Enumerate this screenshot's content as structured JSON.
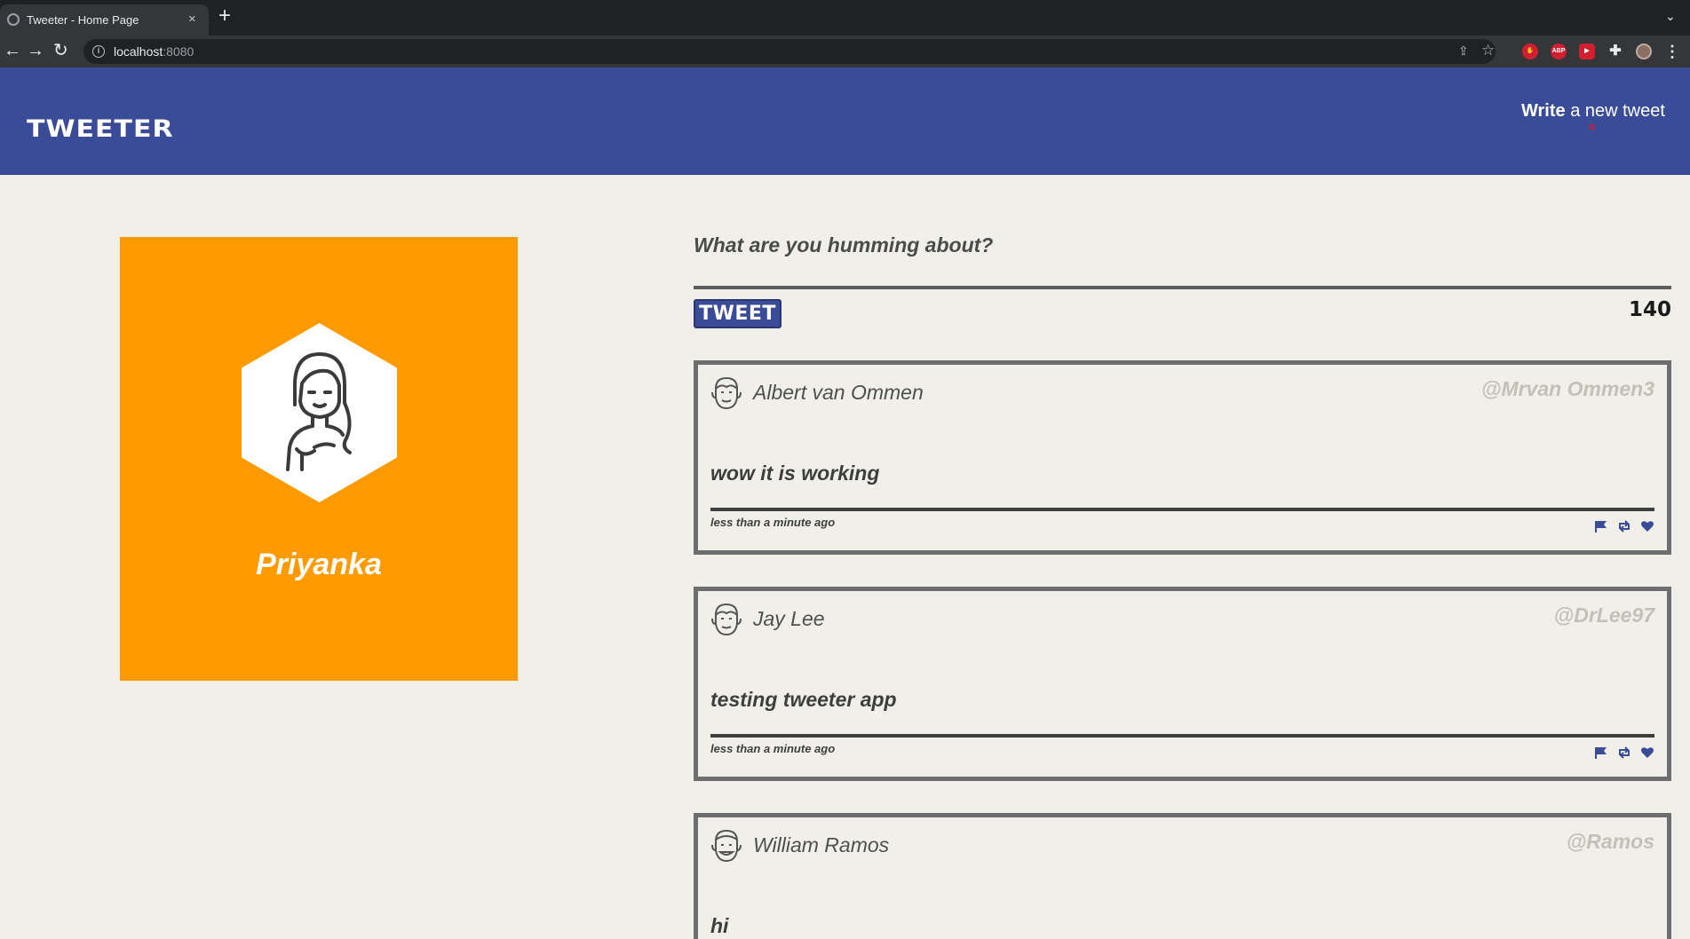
{
  "browser": {
    "tab_title": "Tweeter - Home Page",
    "tab_close": "×",
    "new_tab": "+",
    "url_host": "localhost",
    "url_port": ":8080",
    "ext_abp": "ABP"
  },
  "header": {
    "logo": "TWEETER",
    "compose_strong": "Write",
    "compose_rest": " a new tweet",
    "compose_arrow": "»"
  },
  "profile": {
    "name": "Priyanka",
    "card_color": "#ff9a00"
  },
  "compose": {
    "prompt": "What are you humming about?",
    "button": "TWEET",
    "counter": "140"
  },
  "tweets": [
    {
      "author": "Albert van Ommen",
      "handle": "@Mrvan Ommen3",
      "text": "wow it is working",
      "time": "less than a minute ago"
    },
    {
      "author": "Jay Lee",
      "handle": "@DrLee97",
      "text": "testing tweeter app",
      "time": "less than a minute ago"
    },
    {
      "author": "William Ramos",
      "handle": "@Ramos",
      "text": "hi",
      "time": ""
    }
  ],
  "icons": [
    "flag-icon",
    "retweet-icon",
    "heart-icon",
    "face-icon",
    "avatar-icon"
  ],
  "colors": {
    "header": "#3a4c97",
    "accent_red": "#d01f2f",
    "background": "#f1efe9"
  }
}
